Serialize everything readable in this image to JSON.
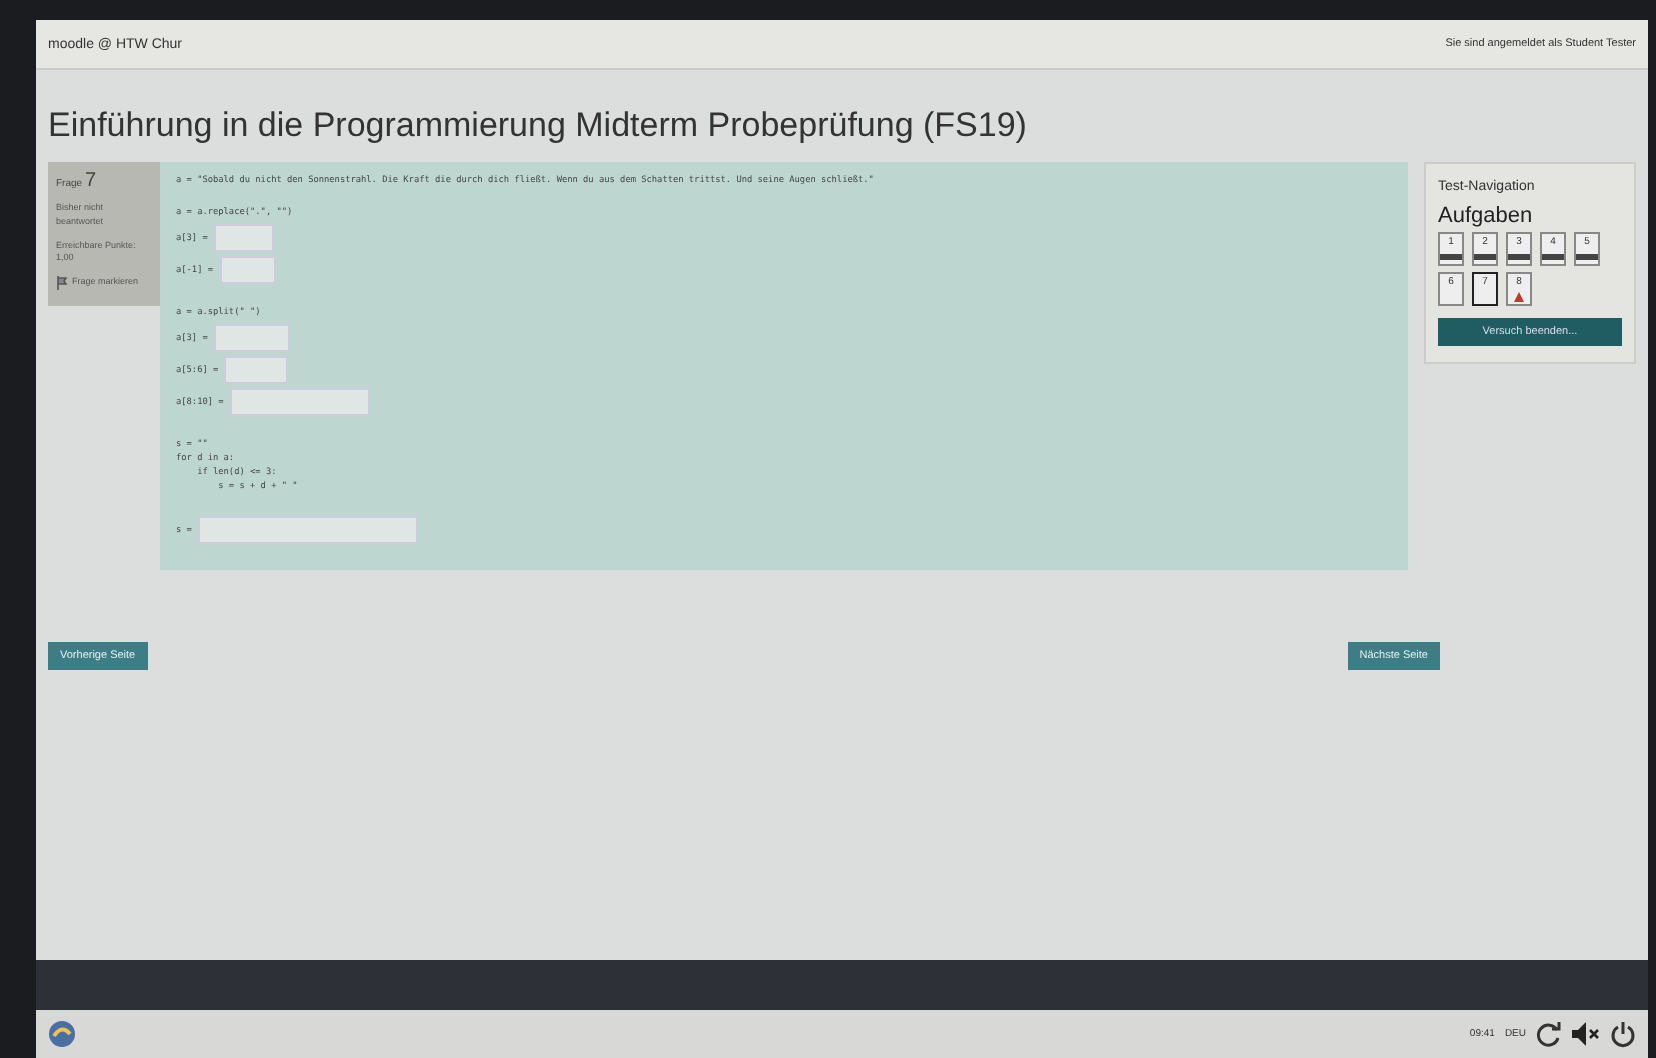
{
  "header": {
    "site": "moodle @ HTW Chur",
    "login": "Sie sind angemeldet als Student Tester"
  },
  "title": "Einführung in die Programmierung Midterm Probeprüfung (FS19)",
  "question_info": {
    "label": "Frage",
    "number": "7",
    "status": "Bisher nicht beantwortet",
    "points": "Erreichbare Punkte: 1,00",
    "flag": "Frage markieren"
  },
  "code": [
    {
      "kind": "code",
      "text": "a = \"Sobald du nicht den Sonnenstrahl. Die Kraft die durch dich fließt. Wenn du aus dem Schatten trittst. Und seine Augen schließt.\""
    },
    {
      "kind": "gap"
    },
    {
      "kind": "code",
      "text": "a = a.replace(\".\", \"\")"
    },
    {
      "kind": "answer",
      "text": "a[3] ="
    },
    {
      "kind": "answer",
      "text": "a[-1] ="
    },
    {
      "kind": "gap"
    },
    {
      "kind": "code",
      "text": "a = a.split(\" \")"
    },
    {
      "kind": "answer",
      "text": "a[3] ="
    },
    {
      "kind": "answer",
      "text": "a[5:6] ="
    },
    {
      "kind": "answer",
      "text": "a[8:10] ="
    },
    {
      "kind": "gap"
    },
    {
      "kind": "code",
      "text": "s = \"\""
    },
    {
      "kind": "code",
      "text": "for d in a:"
    },
    {
      "kind": "code",
      "text": "    if len(d) <= 3:"
    },
    {
      "kind": "code",
      "text": "        s = s + d + \" \""
    },
    {
      "kind": "gap"
    },
    {
      "kind": "answer",
      "text": "s ="
    }
  ],
  "navigation": {
    "title": "Test-Navigation",
    "heading": "Aufgaben",
    "finish": "Versuch beenden...",
    "questions": [
      {
        "label": "1",
        "answered": true,
        "selected": false,
        "flagged": false
      },
      {
        "label": "2",
        "answered": true,
        "selected": false,
        "flagged": false
      },
      {
        "label": "3",
        "answered": true,
        "selected": false,
        "flagged": false
      },
      {
        "label": "4",
        "answered": true,
        "selected": false,
        "flagged": false
      },
      {
        "label": "5",
        "answered": true,
        "selected": false,
        "flagged": false
      },
      {
        "label": "6",
        "answered": false,
        "selected": false,
        "flagged": false
      },
      {
        "label": "7",
        "answered": false,
        "selected": true,
        "flagged": false
      },
      {
        "label": "8",
        "answered": false,
        "selected": false,
        "flagged": true
      }
    ]
  },
  "buttons": {
    "previous": "Vorherige Seite",
    "next": "Nächste Seite"
  },
  "taskbar": {
    "time": "09:41",
    "language": "DEU"
  }
}
